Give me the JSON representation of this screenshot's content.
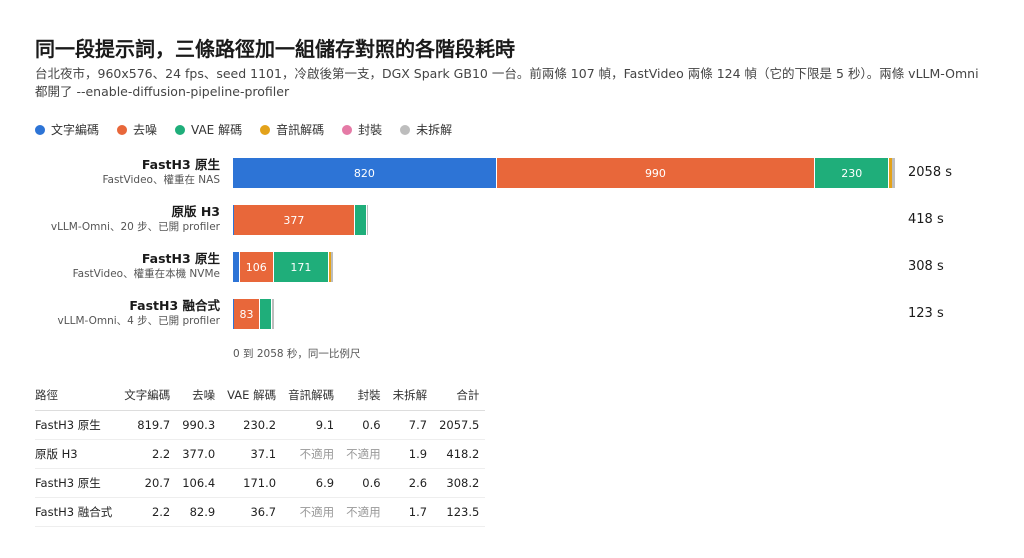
{
  "title": "同一段提示詞，三條路徑加一組儲存對照的各階段耗時",
  "subtitle": "台北夜市，960x576、24 fps、seed 1101，冷啟後第一支，DGX Spark GB10 一台。前兩條 107 幀，FastVideo 兩條 124 幀（它的下限是 5 秒）。兩條 vLLM-Omni 都開了 --enable-diffusion-pipeline-profiler",
  "legend": [
    {
      "label": "文字編碼",
      "color": "#2d74d6"
    },
    {
      "label": "去噪",
      "color": "#e8673a"
    },
    {
      "label": "VAE 解碼",
      "color": "#1fae7a"
    },
    {
      "label": "音訊解碼",
      "color": "#e3a21a"
    },
    {
      "label": "封裝",
      "color": "#e57aa6"
    },
    {
      "label": "未拆解",
      "color": "#bdbdbd"
    }
  ],
  "scale_note": "0 到 2058 秒，同一比例尺",
  "chart_data": {
    "type": "bar",
    "orientation": "horizontal",
    "stacked": true,
    "xlim": [
      0,
      2058
    ],
    "stages": [
      "文字編碼",
      "去噪",
      "VAE 解碼",
      "音訊解碼",
      "封裝",
      "未拆解"
    ],
    "rows": [
      {
        "name": "FastH3 原生",
        "sub": "FastVideo、權重在 NAS",
        "values": [
          819.7,
          990.3,
          230.2,
          9.1,
          0.6,
          7.7
        ],
        "labels": [
          "820",
          "990",
          "230",
          "",
          "",
          ""
        ],
        "total_label": "2058 s"
      },
      {
        "name": "原版 H3",
        "sub": "vLLM-Omni、20 步、已開 profiler",
        "values": [
          2.2,
          377.0,
          37.1,
          0,
          0,
          1.9
        ],
        "labels": [
          "",
          "377",
          "",
          "",
          "",
          ""
        ],
        "total_label": "418 s"
      },
      {
        "name": "FastH3 原生",
        "sub": "FastVideo、權重在本機 NVMe",
        "values": [
          20.7,
          106.4,
          171.0,
          6.9,
          0.6,
          2.6
        ],
        "labels": [
          "",
          "106",
          "171",
          "",
          "",
          ""
        ],
        "total_label": "308 s"
      },
      {
        "name": "FastH3 融合式",
        "sub": "vLLM-Omni、4 步、已開 profiler",
        "values": [
          2.2,
          82.9,
          36.7,
          0,
          0,
          1.7
        ],
        "labels": [
          "",
          "83",
          "",
          "",
          "",
          ""
        ],
        "total_label": "123 s"
      }
    ]
  },
  "table": {
    "headers": [
      "路徑",
      "文字編碼",
      "去噪",
      "VAE 解碼",
      "音訊解碼",
      "封裝",
      "未拆解",
      "合計"
    ],
    "rows": [
      [
        "FastH3 原生",
        "819.7",
        "990.3",
        "230.2",
        "9.1",
        "0.6",
        "7.7",
        "2057.5"
      ],
      [
        "原版 H3",
        "2.2",
        "377.0",
        "37.1",
        "不適用",
        "不適用",
        "1.9",
        "418.2"
      ],
      [
        "FastH3 原生",
        "20.7",
        "106.4",
        "171.0",
        "6.9",
        "0.6",
        "2.6",
        "308.2"
      ],
      [
        "FastH3 融合式",
        "2.2",
        "82.9",
        "36.7",
        "不適用",
        "不適用",
        "1.7",
        "123.5"
      ]
    ]
  }
}
